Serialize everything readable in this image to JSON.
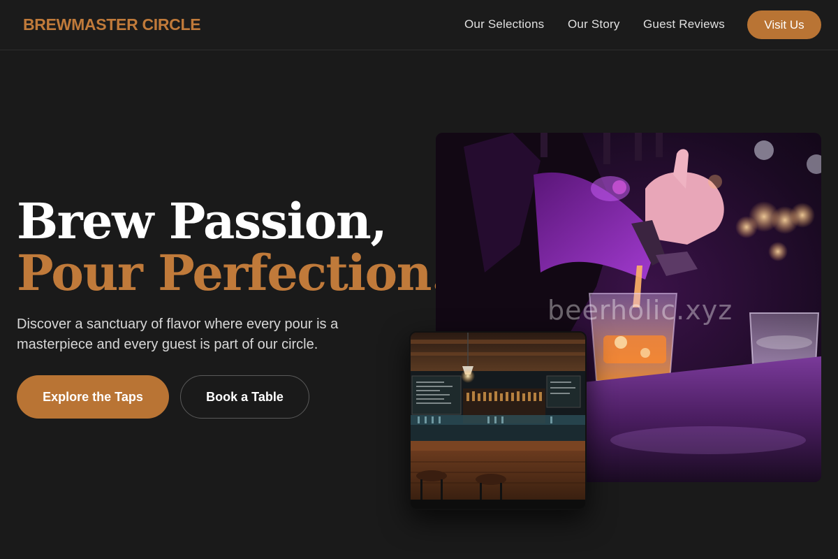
{
  "brand": {
    "name": "BREWMASTER CIRCLE",
    "accent_color": "#c07a3a"
  },
  "nav": {
    "links": [
      "Our Selections",
      "Our Story",
      "Guest Reviews"
    ],
    "cta_label": "Visit Us"
  },
  "hero": {
    "headline_line1": "Brew Passion,",
    "headline_line2": "Pour Perfection.",
    "subtitle": "Discover a sanctuary of flavor where every pour is a masterpiece and every guest is part of our circle.",
    "primary_button": "Explore the Taps",
    "secondary_button": "Book a Table"
  },
  "images": {
    "main_watermark": "beerholic.xyz"
  }
}
